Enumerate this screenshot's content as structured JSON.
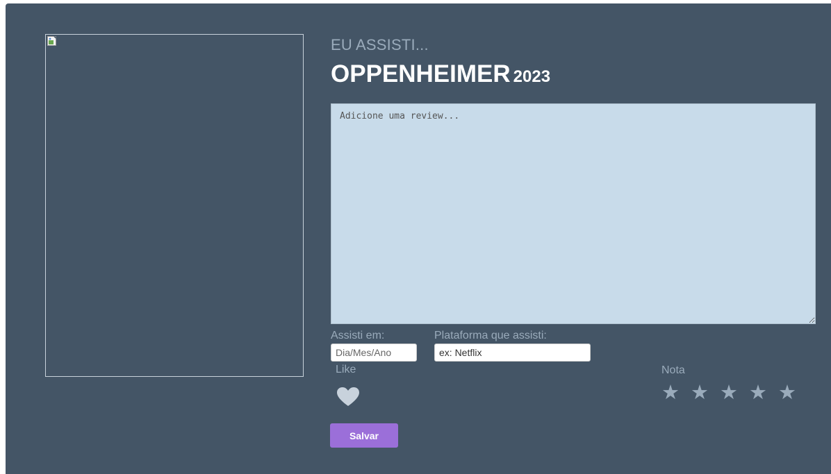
{
  "header": {
    "eyebrow": "EU ASSISTI...",
    "movie_title": "OPPENHEIMER",
    "movie_year": "2023"
  },
  "poster": {
    "icon": "broken-image-icon"
  },
  "review": {
    "placeholder": "Adicione uma review...",
    "value": ""
  },
  "watched_on": {
    "label": "Assisti em:",
    "placeholder": "Dia/Mes/Ano"
  },
  "platform": {
    "label": "Plataforma que assisti:",
    "placeholder": "ex: Netflix"
  },
  "like": {
    "label": "Like",
    "icon": "heart-icon",
    "liked": false
  },
  "rating": {
    "label": "Nota",
    "max": 5,
    "value": 0,
    "icon": "star-icon",
    "stars": [
      "★",
      "★",
      "★",
      "★",
      "★"
    ]
  },
  "actions": {
    "save_label": "Salvar"
  },
  "colors": {
    "panel_bg": "#445566",
    "review_bg": "#c8dbea",
    "muted_text": "#9aabbb",
    "accent": "#9b6fd9"
  }
}
